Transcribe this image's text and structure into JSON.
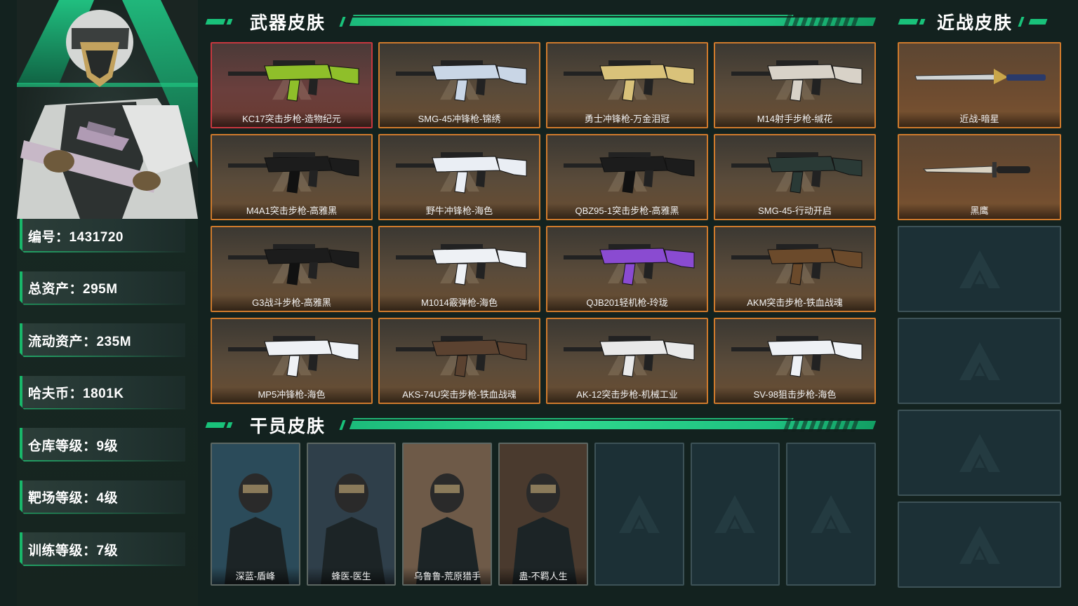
{
  "sections": {
    "weapon_title": "武器皮肤",
    "melee_title": "近战皮肤",
    "operator_title": "干员皮肤"
  },
  "stats": [
    {
      "text": "编号：1431720"
    },
    {
      "text": "总资产：295M"
    },
    {
      "text": "流动资产：235M"
    },
    {
      "text": "哈夫币：1801K"
    },
    {
      "text": "仓库等级：9级"
    },
    {
      "text": "靶场等级：4级"
    },
    {
      "text": "训练等级：7级"
    }
  ],
  "weapons": [
    {
      "name": "KC17突击步枪-造物纪元",
      "icon": "rifle-icon",
      "color": "#8fbf2a",
      "featured": true
    },
    {
      "name": "SMG-45冲锋枪-锦绣",
      "icon": "smg-icon",
      "color": "#c9d6e6"
    },
    {
      "name": "勇士冲锋枪-万金泪冠",
      "icon": "smg-icon",
      "color": "#d9c27a"
    },
    {
      "name": "M14射手步枪-缄花",
      "icon": "marksman-rifle-icon",
      "color": "#d8d2c8"
    },
    {
      "name": "M4A1突击步枪-高雅黑",
      "icon": "rifle-icon",
      "color": "#1c1c1c"
    },
    {
      "name": "野牛冲锋枪-海色",
      "icon": "smg-icon",
      "color": "#eaeef4"
    },
    {
      "name": "QBZ95-1突击步枪-高雅黑",
      "icon": "bullpup-rifle-icon",
      "color": "#1c1c1c"
    },
    {
      "name": "SMG-45-行动开启",
      "icon": "smg-icon",
      "color": "#2a3a36"
    },
    {
      "name": "G3战斗步枪-高雅黑",
      "icon": "rifle-icon",
      "color": "#1c1c1c"
    },
    {
      "name": "M1014霰弹枪-海色",
      "icon": "shotgun-icon",
      "color": "#eef1f5"
    },
    {
      "name": "QJB201轻机枪-玲珑",
      "icon": "lmg-icon",
      "color": "#8a4bd1"
    },
    {
      "name": "AKM突击步枪-铁血战魂",
      "icon": "rifle-icon",
      "color": "#6b4a2b"
    },
    {
      "name": "MP5冲锋枪-海色",
      "icon": "smg-icon",
      "color": "#eef1f5"
    },
    {
      "name": "AKS-74U突击步枪-铁血战魂",
      "icon": "rifle-icon",
      "color": "#5b4230"
    },
    {
      "name": "AK-12突击步枪-机械工业",
      "icon": "rifle-icon",
      "color": "#e9e9e9"
    },
    {
      "name": "SV-98狙击步枪-海色",
      "icon": "sniper-rifle-icon",
      "color": "#eef1f5"
    }
  ],
  "melee": [
    {
      "name": "近战-暗星",
      "icon": "blade-icon"
    },
    {
      "name": "黑鹰",
      "icon": "knife-icon"
    }
  ],
  "operators": [
    {
      "name": "深蓝-盾峰",
      "icon": "operator-portrait-icon",
      "color": "#2b4b5a"
    },
    {
      "name": "蜂医-医生",
      "icon": "operator-portrait-icon",
      "color": "#2f3f4a"
    },
    {
      "name": "乌鲁鲁-荒原猎手",
      "icon": "operator-portrait-icon",
      "color": "#6e5a48"
    },
    {
      "name": "蛊-不羁人生",
      "icon": "operator-portrait-icon",
      "color": "#4a3a2e"
    }
  ],
  "colors": {
    "accent_green": "#19c27a",
    "card_border": "#cf7a2c",
    "featured_border": "#c7373f",
    "empty_slot": "#1c3036"
  }
}
